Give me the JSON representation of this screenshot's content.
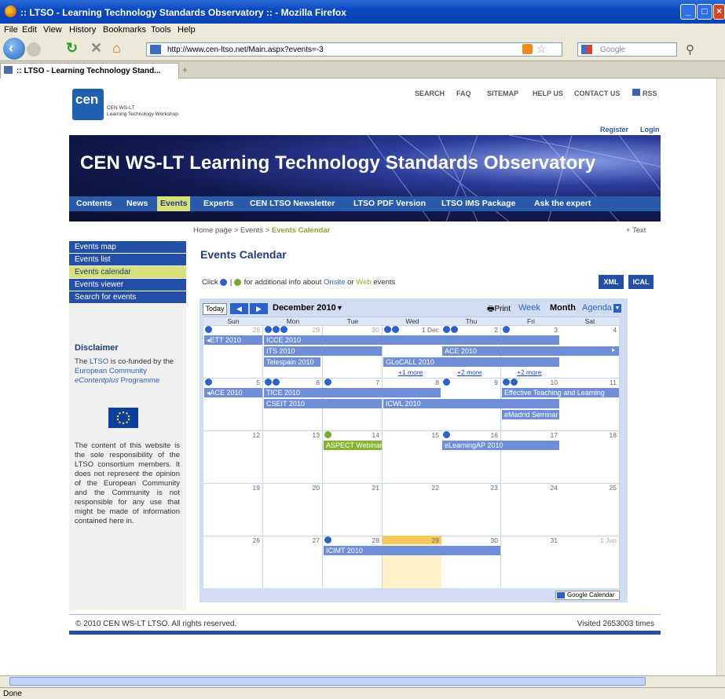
{
  "window": {
    "title": ":: LTSO - Learning Technology Standards Observatory :: - Mozilla Firefox"
  },
  "menu": [
    "File",
    "Edit",
    "View",
    "History",
    "Bookmarks",
    "Tools",
    "Help"
  ],
  "browser": {
    "url": "http://www.cen-ltso.net/Main.aspx?events=-3",
    "search_placeholder": "Google",
    "tab_title": ":: LTSO - Learning Technology Stand...",
    "status": "Done"
  },
  "site": {
    "logo_text": "cen",
    "org_line1": "CEN WS-LT",
    "org_line2": "Learning Technology Workshop",
    "top_links": [
      "SEARCH",
      "FAQ",
      "SITEMAP",
      "HELP US",
      "CONTACT US",
      "RSS"
    ],
    "register": "Register",
    "login": "Login",
    "banner_title": "CEN WS-LT Learning Technology Standards Observatory",
    "nav": [
      "Contents",
      "News",
      "Events",
      "Experts",
      "CEN LTSO Newsletter",
      "LTSO PDF Version",
      "LTSO IMS Package",
      "Ask the expert"
    ],
    "breadcrumb": [
      "Home page",
      ">",
      "Events",
      ">",
      "Events Calendar"
    ],
    "text_size": "+ Text",
    "sidebar": [
      "Events map",
      "Events list",
      "Events calendar",
      "Events viewer",
      "Search for events"
    ],
    "disclaimer_title": "Disclaimer",
    "disclaimer_1": [
      "The ",
      "LTSO",
      " is co-funded by the ",
      "European Community ",
      "eContentplus",
      " Programme"
    ],
    "disclaimer_2": "The content of this website is the sole responsibility of the LTSO consortium members. It does not represent the opinion of the European Community and the Community is not responsible for any use that might be made of information contained here in.",
    "page_title": "Events Calendar",
    "info_line": [
      "Click",
      " | ",
      "for additional info about ",
      "Onsite",
      " or ",
      "Web",
      " events"
    ],
    "xml": "XML",
    "ical": "ICAL",
    "footer_copy": "© 2010 CEN WS-LT LTSO. All rights reserved.",
    "footer_visits": "Visited 2653003 times"
  },
  "calendar": {
    "today": "Today",
    "month_label": "December 2010",
    "print": "Print",
    "views": [
      "Week",
      "Month",
      "Agenda"
    ],
    "weekdays": [
      "Sun",
      "Mon",
      "Tue",
      "Wed",
      "Thu",
      "Fri",
      "Sat"
    ],
    "weeks": [
      [
        "28",
        "29",
        "30",
        "1 Dec",
        "2",
        "3",
        "4"
      ],
      [
        "5",
        "6",
        "7",
        "8",
        "9",
        "10",
        "11"
      ],
      [
        "12",
        "13",
        "14",
        "15",
        "16",
        "17",
        "18"
      ],
      [
        "19",
        "20",
        "21",
        "22",
        "23",
        "24",
        "25"
      ],
      [
        "26",
        "27",
        "28",
        "29",
        "30",
        "31",
        "1 Jan"
      ]
    ],
    "events": [
      "ETT 2010",
      "ICCE 2010",
      "ITS 2010",
      "ACE 2010",
      "Telespain 2010",
      "GLoCALL 2010",
      "ACE 2010",
      "TICE 2010",
      "Effective Teaching and Learning",
      "CSEIT 2010",
      "ICWL 2010",
      "eMadrid Seminar",
      "ASPECT Webinar",
      "eLearningAP 2010",
      "ICIMT 2010"
    ],
    "more": [
      "+1 more",
      "+2 more",
      "+2 more"
    ],
    "google_badge": "Google Calendar"
  }
}
